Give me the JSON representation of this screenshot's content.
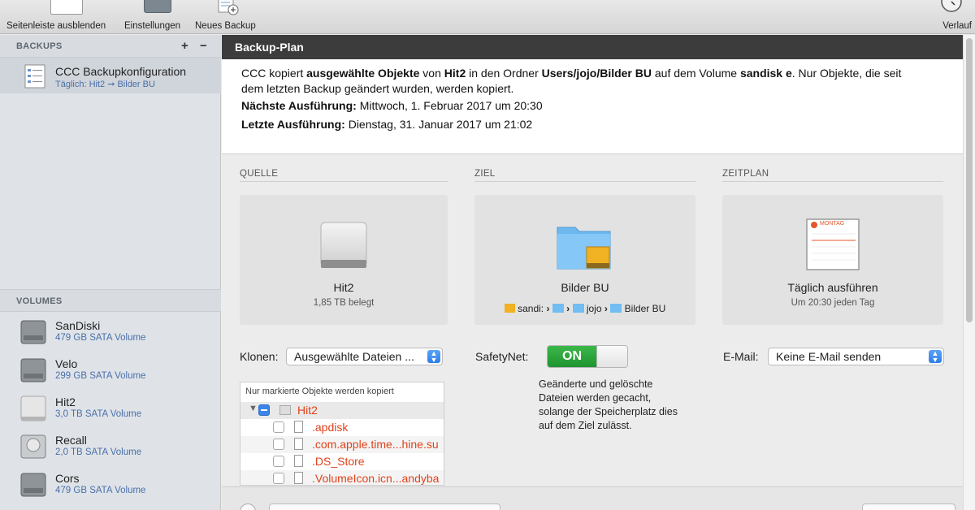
{
  "toolbar": {
    "hide_sidebar": "Seitenleiste ausblenden",
    "settings": "Einstellungen",
    "new_backup": "Neues Backup",
    "history": "Verlauf"
  },
  "sidebar": {
    "backups_header": "BACKUPS",
    "add": "+",
    "remove": "−",
    "backup": {
      "name": "CCC Backupkonfiguration",
      "schedule": "Täglich: Hit2 ➞ Bilder BU"
    },
    "volumes_header": "VOLUMES",
    "volumes": [
      {
        "name": "SanDiski",
        "info": "479 GB SATA Volume"
      },
      {
        "name": "Velo",
        "info": "299 GB SATA Volume"
      },
      {
        "name": "Hit2",
        "info": "3,0 TB SATA Volume"
      },
      {
        "name": "Recall",
        "info": "2,0 TB SATA Volume"
      },
      {
        "name": "Cors",
        "info": "479 GB SATA Volume"
      }
    ]
  },
  "plan": {
    "title": "Backup-Plan",
    "desc_1": "CCC kopiert ",
    "desc_b1": "ausgewählte Objekte",
    "desc_2": " von ",
    "desc_b2": "Hit2",
    "desc_3": " in den Ordner ",
    "desc_b3": "Users/jojo/Bilder BU",
    "desc_4": " auf dem Volume ",
    "desc_b4": "sandisk e",
    "desc_5": ". Nur Objekte, die seit",
    "desc_line2": "dem letzten Backup geändert wurden, werden kopiert.",
    "next_label": "Nächste Ausführung:",
    "next_value": " Mittwoch, 1. Februar 2017 um 20:30",
    "last_label": "Letzte Ausführung:",
    "last_value": " Dienstag, 31. Januar 2017 um 21:02"
  },
  "source": {
    "header": "QUELLE",
    "name": "Hit2",
    "info": "1,85 TB belegt"
  },
  "target": {
    "header": "ZIEL",
    "name": "Bilder BU",
    "path": [
      "sandi:",
      "›",
      "›",
      "jojo",
      "›",
      "Bilder BU"
    ]
  },
  "schedule": {
    "header": "ZEITPLAN",
    "cal_label": "MONTAG",
    "name": "Täglich ausführen",
    "info": "Um 20:30 jeden Tag"
  },
  "clone": {
    "label": "Klonen:",
    "value": "Ausgewählte Dateien ...",
    "tree_header": "Nur markierte Objekte werden kopiert",
    "root": "Hit2",
    "items": [
      ".apdisk",
      ".com.apple.time...hine.su",
      ".DS_Store",
      ".VolumeIcon.icn...andyba"
    ]
  },
  "safetynet": {
    "label": "SafetyNet:",
    "state": "ON",
    "text": "Geänderte und gelöschte Dateien werden gecacht, solange der Speicherplatz dies auf dem Ziel zulässt."
  },
  "email": {
    "label": "E-Mail:",
    "value": "Keine E-Mail senden"
  },
  "colors": {
    "accent": "#2f7ee8",
    "on_green": "#2aa83b",
    "excluded_red": "#e0421b",
    "header_dark": "#3c3c3c"
  }
}
